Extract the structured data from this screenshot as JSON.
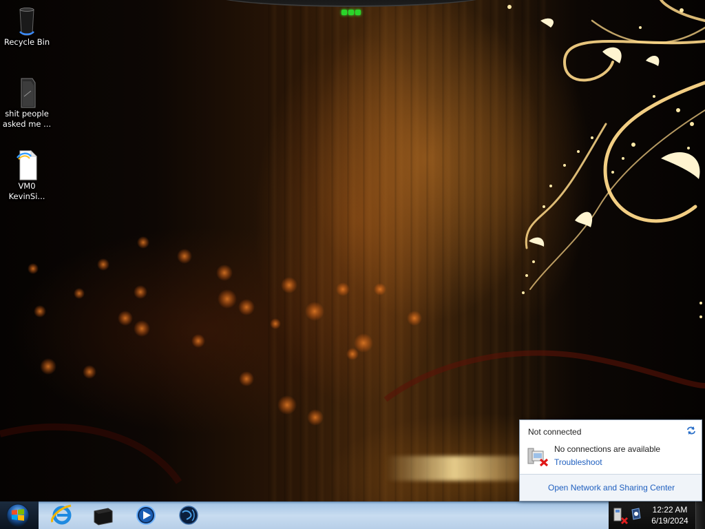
{
  "desktop": {
    "icons": [
      {
        "name": "recycle-bin",
        "label": "Recycle Bin"
      },
      {
        "name": "file-shortcut",
        "label": "shit people asked me ..."
      },
      {
        "name": "text-document",
        "label": "VM0 KevinSi..."
      }
    ]
  },
  "taskbar": {
    "start": {
      "icon": "windows-orb-icon"
    },
    "pinned": [
      {
        "name": "internet-explorer",
        "icon": "ie-icon"
      },
      {
        "name": "black-box-app",
        "icon": "black-box-icon"
      },
      {
        "name": "media-player",
        "icon": "media-player-icon"
      },
      {
        "name": "globe-app",
        "icon": "globe-icon"
      }
    ],
    "tray": {
      "time": "12:22 AM",
      "date": "6/19/2024"
    }
  },
  "network_flyout": {
    "title": "Not connected",
    "status": "No connections are available",
    "troubleshoot": "Troubleshoot",
    "footer_link": "Open Network and Sharing Center"
  },
  "colors": {
    "link": "#1f5fbf",
    "taskbar": "#b7cfe8"
  }
}
